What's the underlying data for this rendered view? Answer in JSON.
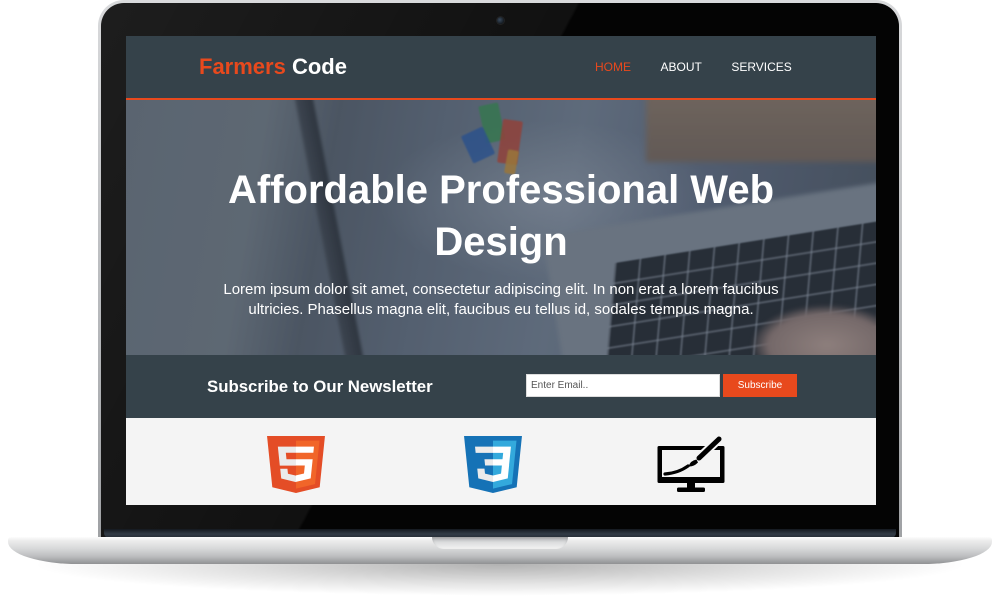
{
  "site": {
    "brand": {
      "highlight": "Farmers",
      "rest": "Code"
    },
    "nav": [
      {
        "label": "HOME",
        "active": true
      },
      {
        "label": "ABOUT",
        "active": false
      },
      {
        "label": "SERVICES",
        "active": false
      }
    ]
  },
  "showcase": {
    "heading": "Affordable Professional Web Design",
    "text": "Lorem ipsum dolor sit amet, consectetur adipiscing elit. In non erat a lorem faucibus ultricies. Phasellus magna elit, faucibus eu tellus id, sodales tempus magna."
  },
  "newsletter": {
    "title": "Subscribe to Our Newsletter",
    "email_placeholder": "Enter Email..",
    "email_value": "",
    "button_label": "Subscribe"
  },
  "boxes": [
    {
      "icon": "html5-icon"
    },
    {
      "icon": "css3-icon"
    },
    {
      "icon": "monitor-brush-icon"
    }
  ],
  "colors": {
    "accent": "#e8491d",
    "dark_bg": "#35424a",
    "light_bg": "#f4f4f4"
  }
}
